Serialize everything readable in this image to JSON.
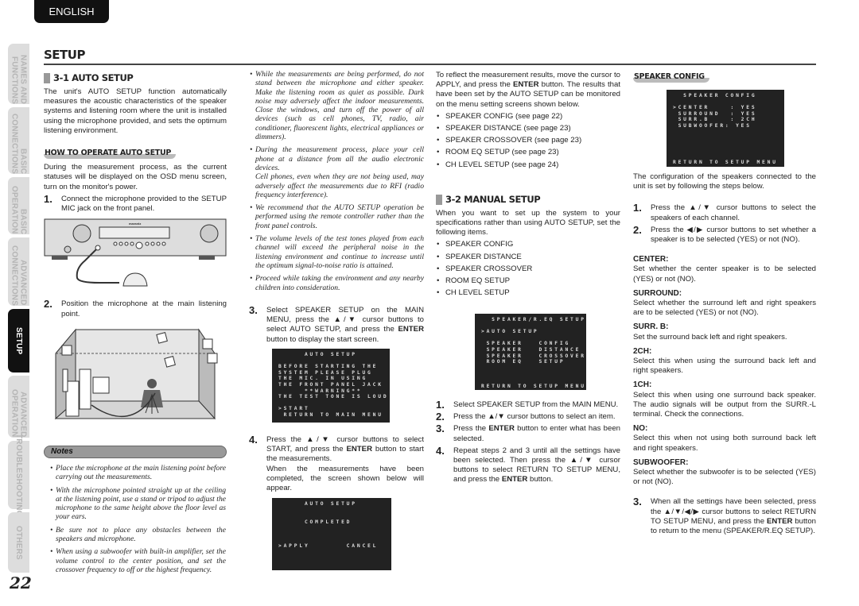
{
  "language_tab": "ENGLISH",
  "side_tabs": [
    {
      "label": "NAMES AND FUNCTIONS"
    },
    {
      "label": "BASIC CONNECTIONS"
    },
    {
      "label": "BASIC OPERATION"
    },
    {
      "label": "ADVANCED CONNECTIONS"
    },
    {
      "label": "SETUP",
      "active": true
    },
    {
      "label": "ADVANCED OPERATION"
    },
    {
      "label": "TROUBLESHOOTING"
    },
    {
      "label": "OTHERS"
    }
  ],
  "page_title": "SETUP",
  "page_number": "22",
  "col1": {
    "heading": "3-1 AUTO SETUP",
    "intro": "The unit's AUTO SETUP function automatically measures the acoustic characteristics of the speaker systems and listening room where the unit is installed using the microphone provided, and sets the optimum listening environment.",
    "subheading": "HOW TO OPERATE AUTO SETUP",
    "para": "During the measurement process, as the current statuses will be displayed on the OSD menu screen, turn on the monitor's power.",
    "step1": "Connect the microphone provided to the SETUP MIC jack on the front panel.",
    "step2": "Position the microphone at the main listening point.",
    "receiver_logo": "marantz",
    "notes_label": "Notes",
    "notes": [
      "Place the microphone at the main listening point before carrying out the measurements.",
      "With the microphone pointed straight up at the ceiling at the listening point, use a stand or tripod to adjust the microphone to the same height above the floor level as your ears.",
      "Be sure not to place any obstacles between the speakers and microphone.",
      "When using a subwoofer with built-in amplifier, set the volume control to the center position, and set the crossover frequency to off or the highest frequency."
    ]
  },
  "col2": {
    "cautions": [
      "While the measurements are being performed, do not stand between the microphone and either speaker. Make the listening room as quiet as possible. Dark noise may adversely affect the indoor measurements. Close the windows, and turn off the power of all devices (such as cell phones, TV, radio, air conditioner, fluorescent lights, electrical appliances or dimmers).",
      "During the measurement process, place your cell phone at a distance from all the audio electronic devices.\nCell phones, even when they are not being used, may adversely affect the measurements due to RFI (radio frequency interference).",
      "We recommend that the AUTO SETUP operation be performed using the remote controller rather than the front panel controls.",
      "The volume levels of the test tones played from each channel will exceed the peripheral noise in the listening environment and continue to increase until the optimum signal-to-noise ratio is attained.",
      "Proceed while taking the environment and any nearby children into consideration."
    ],
    "step3": {
      "pre": "Select SPEAKER SETUP on the MAIN MENU, press the ▲/▼ cursor buttons to select AUTO SETUP, and press the ",
      "b": "ENTER",
      "post": " button to display the start screen."
    },
    "osd1": "     AUTO SETUP\n\nBEFORE STARTING THE\nSYSTEM PLEASE PLUG\nTHE MIC. IN USING\nTHE FRONT PANEL JACK\n     **WARNING**\nTHE TEST TONE IS LOUD\n\n>START\n RETURN TO MAIN MENU",
    "step4": {
      "pre": "Press the ▲/▼ cursor buttons to select START, and press the ",
      "b": "ENTER",
      "post": " button to start the measurements.\nWhen the measurements have been completed, the screen shown below will appear."
    },
    "osd2": "     AUTO SETUP\n\n\n     COMPLETED\n\n\n\n>APPLY       CANCEL"
  },
  "col3": {
    "para": {
      "pre": "To reflect the measurement results, move the cursor to APPLY, and press the ",
      "b": "ENTER",
      "post": " button. The results that have been set by the AUTO SETUP can be monitored on the menu setting screens shown below."
    },
    "refs": [
      "SPEAKER CONFIG (see page 22)",
      "SPEAKER DISTANCE (see page 23)",
      "SPEAKER CROSSOVER (see page 23)",
      "ROOM EQ SETUP (see page 23)",
      "CH LEVEL SETUP (see page 24)"
    ],
    "heading": "3-2 MANUAL SETUP",
    "intro": "When you want to set up the system to your specifications rather than using AUTO SETUP, set the following items.",
    "items": [
      "SPEAKER CONFIG",
      "SPEAKER DISTANCE",
      "SPEAKER CROSSOVER",
      "ROOM EQ SETUP",
      "CH LEVEL SETUP"
    ],
    "osd": "  SPEAKER/R.EQ SETUP\n\n>AUTO SETUP\n\n SPEAKER   CONFIG\n SPEAKER   DISTANCE\n SPEAKER   CROSSOVER\n ROOM EQ   SETUP\n\n\n\nRETURN TO SETUP MENU",
    "steps": [
      {
        "pre": "Select SPEAKER SETUP from the MAIN MENU.",
        "b": "",
        "post": ""
      },
      {
        "pre": "Press the ▲/▼ cursor buttons to select an item.",
        "b": "",
        "post": ""
      },
      {
        "pre": "Press the ",
        "b": "ENTER",
        "post": " button to enter what has been selected."
      },
      {
        "pre": "Repeat steps 2 and 3 until all the settings have been selected. Then press the ▲/▼ cursor buttons to select RETURN TO SETUP MENU, and press the ",
        "b": "ENTER",
        "post": " button."
      }
    ]
  },
  "col4": {
    "subheading": "SPEAKER CONFIG",
    "osd": "  SPEAKER CONFIG\n\n>CENTER    : YES\n SURROUND  : YES\n SURR.B    : 2CH\n SUBWOOFER: YES\n\n\n\n\n\nRETURN TO SETUP MENU",
    "intro": "The configuration of the speakers connected to the unit is set by following the steps below.",
    "step1": "Press the ▲/▼ cursor buttons to select the speakers of each channel.",
    "step2": "Press the ◀/▶ cursor buttons to set whether a speaker is to be selected (YES) or not (NO).",
    "defs": [
      {
        "term": "CENTER:",
        "desc": "Set whether the center speaker is to be selected (YES) or not (NO)."
      },
      {
        "term": "SURROUND:",
        "desc": "Select whether the surround left and right speakers are to be selected (YES) or not (NO)."
      },
      {
        "term": "SURR. B:",
        "desc": "Set the surround back left and right speakers."
      },
      {
        "term": "2CH:",
        "desc": "Select this when using the surround back left and right speakers."
      },
      {
        "term": "1CH:",
        "desc": "Select this when using one surround back speaker. The audio signals will be output from the SURR.-L terminal. Check the connections."
      },
      {
        "term": "NO:",
        "desc": "Select this when not using both surround back left and right speakers."
      },
      {
        "term": "SUBWOOFER:",
        "desc": "Select whether the subwoofer is to be selected (YES) or not (NO)."
      }
    ],
    "step3": {
      "pre": "When all the settings have been selected, press the ▲/▼/◀/▶ cursor buttons to select RETURN TO SETUP MENU, and press the ",
      "b": "ENTER",
      "post": " button to return to the menu (SPEAKER/R.EQ SETUP)."
    }
  }
}
